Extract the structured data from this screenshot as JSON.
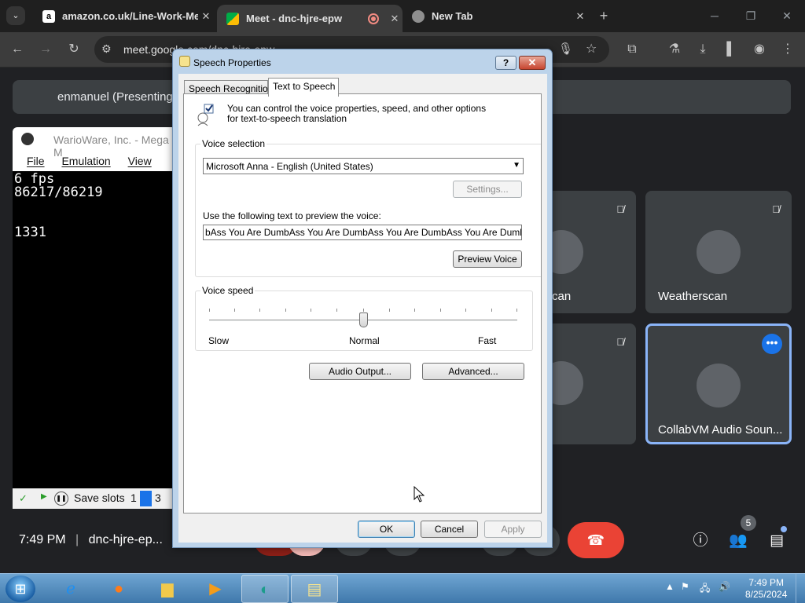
{
  "browser": {
    "tab_search_icon": "chevron-down-icon",
    "tabs": [
      {
        "title": "amazon.co.uk/Line-Work-Melv",
        "favicon": "amazon-favicon"
      },
      {
        "title": "Meet - dnc-hjre-epw",
        "favicon": "meet-favicon",
        "recording": true
      },
      {
        "title": "New Tab",
        "favicon": "chrome-favicon"
      }
    ],
    "new_tab": "+",
    "url": "meet.google.com/dnc-hjre-epw",
    "window_controls": {
      "minimize": "─",
      "maximize": "❐",
      "close": "✕"
    }
  },
  "meet": {
    "presenting_label": "enmanuel (Presenting",
    "emulator": {
      "title": "WarioWare, Inc. - Mega M",
      "menu": [
        "File",
        "Emulation",
        "View"
      ],
      "lines": [
        "6 fps",
        "86217/86219",
        "",
        "",
        "1331"
      ],
      "status": {
        "save_label": "Save slots",
        "slot1": "1",
        "slot3": "3"
      }
    },
    "tiles": [
      {
        "name": "can"
      },
      {
        "name": "Weatherscan"
      },
      {
        "name": ""
      },
      {
        "name": "CollabVM Audio Soun..."
      }
    ],
    "meeting_time": "7:49 PM",
    "meeting_code": "dnc-hjre-ep...",
    "participants_count": "5"
  },
  "dialog": {
    "title": "Speech Properties",
    "help": "?",
    "close": "✕",
    "tabs": [
      "Speech Recognition",
      "Text to Speech"
    ],
    "intro": "You can control the voice properties, speed, and other options for text-to-speech translation",
    "voice_selection_label": "Voice selection",
    "voice_selected": "Microsoft Anna - English (United States)",
    "settings_button": "Settings...",
    "preview_label": "Use the following text to preview the voice:",
    "preview_text": "bAss You Are DumbAss You Are DumbAss You Are DumbAss You Are DumbAss You",
    "preview_button": "Preview Voice",
    "voice_speed_label": "Voice speed",
    "speed_labels": {
      "slow": "Slow",
      "normal": "Normal",
      "fast": "Fast"
    },
    "speed_level": 0.5,
    "audio_output_button": "Audio Output...",
    "advanced_button": "Advanced...",
    "ok_button": "OK",
    "cancel_button": "Cancel",
    "apply_button": "Apply"
  },
  "taskbar": {
    "time": "7:49 PM",
    "date": "8/25/2024"
  }
}
